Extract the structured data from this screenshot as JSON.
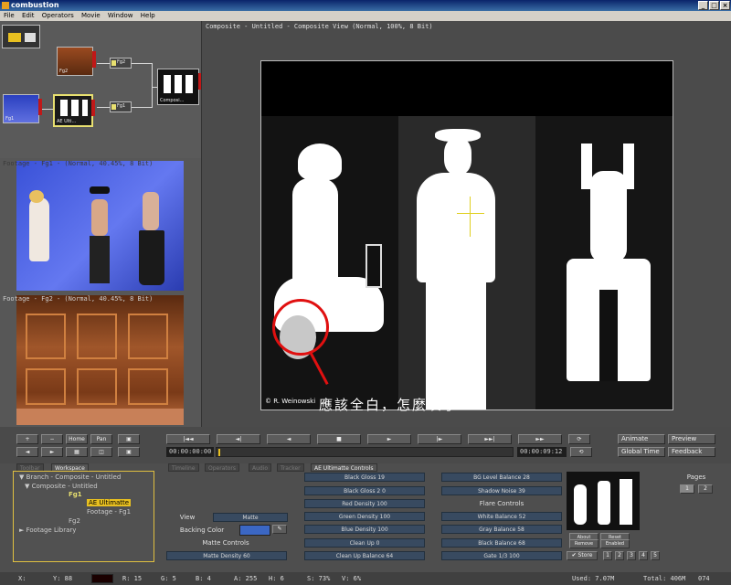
{
  "app": {
    "title": "combustion"
  },
  "menu": [
    "File",
    "Edit",
    "Operators",
    "Movie",
    "Window",
    "Help"
  ],
  "schematic": {
    "nodes": {
      "fg2": "Fg2",
      "fg1": "Fg1",
      "ae_ult": "AE Ulti...",
      "comp": "Composi..."
    },
    "ops": {
      "op1": "Fg2",
      "op2": "Fg1"
    }
  },
  "footage_fg1": {
    "label": "Footage - Fg1 - (Normal, 40.45%, 8 Bit)"
  },
  "footage_fg2": {
    "label": "Footage - Fg2 - (Normal, 40.45%, 8 Bit)"
  },
  "composite": {
    "title": "Composite - Untitled - Composite View (Normal, 100%, 8 Bit)",
    "credit": "© R. Weinowski",
    "annotation": "應該全白，怎麼灰了"
  },
  "transport": {
    "buttons": {
      "home": "Home",
      "pan": "Pan",
      "animate": "Animate",
      "preview": "Preview",
      "global_time": "Global Time",
      "feedback": "Feedback"
    },
    "time_start": "00:00:00:00",
    "time_end": "00:00:09:12"
  },
  "tabs": [
    "Toolbar",
    "Workspace",
    "Timeline",
    "Operators",
    "Audio",
    "Tracker",
    "AE Ultimatte Controls"
  ],
  "tree": {
    "branch": "Branch - Composite - Untitled",
    "composite": "Composite - Untitled",
    "fg1": "Fg1",
    "ae_ultimatte": "AE Ultimatte",
    "footage_fg1": "Footage - Fg1",
    "fg2": "Fg2",
    "footage_library": "Footage Library"
  },
  "controls": {
    "view_label": "View",
    "view_value": "Matte",
    "backing_color_label": "Backing Color",
    "backing_color": "#3b67c4",
    "matte_controls": "Matte Controls",
    "matte_density": "Matte Density 60",
    "black_gloss": "Black Gloss 19",
    "black_gloss_2": "Black Gloss 2 0",
    "red_density": "Red Density 100",
    "green_density": "Green Density 100",
    "blue_density": "Blue Density 100",
    "clean_up": "Clean Up 0",
    "clean_up_balance": "Clean Up Balance 64",
    "bg_level_balance": "BG Level Balance 28",
    "shadow_noise": "Shadow Noise 39",
    "flare_controls": "Flare Controls",
    "white_balance": "White Balance 52",
    "gray_balance": "Gray Balance 58",
    "black_balance": "Black Balance 68",
    "gate": "Gate 1/3 100",
    "about": "About",
    "reset": "Reset",
    "remove": "Remove",
    "enabled": "Enabled",
    "store": "Store",
    "store_slots": [
      "1",
      "2",
      "3",
      "4",
      "5"
    ],
    "pages_label": "Pages",
    "pages": [
      "1",
      "2"
    ]
  },
  "status": {
    "x": "X:",
    "y": "Y: 88",
    "r": "R: 15",
    "g": "G: 5",
    "b": "B: 4",
    "a": "A: 255",
    "h": "H: 6",
    "s": "S: 73%",
    "v": "V: 6%",
    "used": "Used: 7.07M",
    "total": "Total: 406M",
    "frame": "074"
  }
}
